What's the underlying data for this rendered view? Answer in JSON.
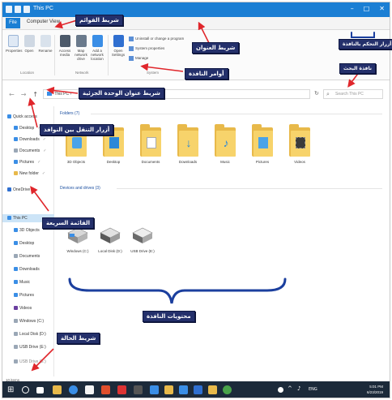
{
  "window": {
    "title": "This PC",
    "controls": [
      "–",
      "□",
      "✕"
    ]
  },
  "ribbon": {
    "tabs": [
      "File",
      "Computer",
      "View"
    ],
    "items": [
      {
        "label": "Properties"
      },
      {
        "label": "Open"
      },
      {
        "label": "Rename"
      },
      {
        "label": "Access media"
      },
      {
        "label": "Map network drive"
      },
      {
        "label": "Add a network location"
      },
      {
        "label": "Open Settings"
      }
    ],
    "small_items": [
      "Uninstall or change a program",
      "System properties",
      "Manage"
    ],
    "groups": [
      "Location",
      "Network",
      "System"
    ]
  },
  "address": {
    "back": "←",
    "forward": "→",
    "up": "↑",
    "path": "This PC",
    "separator": "›",
    "refresh": "↻",
    "search_placeholder": "Search This PC"
  },
  "sidebar": {
    "items": [
      {
        "label": "Quick access",
        "color": "#3a8ee6",
        "pin": ""
      },
      {
        "label": "Desktop",
        "color": "#3a8ee6",
        "pin": "✓"
      },
      {
        "label": "Downloads",
        "color": "#3a8ee6",
        "pin": "✓"
      },
      {
        "label": "Documents",
        "color": "#9aa7b6",
        "pin": "✓"
      },
      {
        "label": "Pictures",
        "color": "#3a8ee6",
        "pin": "✓"
      },
      {
        "label": "New folder",
        "color": "#e8b94a",
        "pin": "✓"
      },
      {
        "label": "OneDrive",
        "color": "#2f6fd0",
        "pin": ""
      },
      {
        "label": "This PC",
        "color": "#3a8ee6",
        "pin": ""
      },
      {
        "label": "3D Objects",
        "color": "#3a8ee6",
        "pin": ""
      },
      {
        "label": "Desktop",
        "color": "#3a8ee6",
        "pin": ""
      },
      {
        "label": "Documents",
        "color": "#9aa7b6",
        "pin": ""
      },
      {
        "label": "Downloads",
        "color": "#3a8ee6",
        "pin": ""
      },
      {
        "label": "Music",
        "color": "#3a8ee6",
        "pin": ""
      },
      {
        "label": "Pictures",
        "color": "#3a8ee6",
        "pin": ""
      },
      {
        "label": "Videos",
        "color": "#6b3fa0",
        "pin": ""
      },
      {
        "label": "Windows (C:)",
        "color": "#9aa7b6",
        "pin": ""
      },
      {
        "label": "Local Disk (D:)",
        "color": "#9aa7b6",
        "pin": ""
      },
      {
        "label": "USB Drive (E:)",
        "color": "#9aa7b6",
        "pin": ""
      },
      {
        "label": "USB Drive (E:)",
        "color": "#9aa7b6",
        "pin": ""
      }
    ]
  },
  "content": {
    "folders_header": "Folders (7)",
    "folders": [
      {
        "label": "3D Objects",
        "emblem": "#4aa3e8"
      },
      {
        "label": "Desktop",
        "emblem": "#2b88d8"
      },
      {
        "label": "Documents",
        "emblem": "#ffffff"
      },
      {
        "label": "Downloads",
        "emblem": "#2b88d8"
      },
      {
        "label": "Music",
        "emblem": "#2b88d8"
      },
      {
        "label": "Pictures",
        "emblem": "#4aa3e8"
      },
      {
        "label": "Videos",
        "emblem": "#3b3b3b"
      }
    ],
    "devices_header": "Devices and drives (3)",
    "drives": [
      {
        "label": "Windows (C:)"
      },
      {
        "label": "Local Disk (D:)"
      },
      {
        "label": "USB Drive (E:)"
      }
    ]
  },
  "statusbar": {
    "text": "10 items"
  },
  "taskbar": {
    "icons": [
      {
        "name": "start",
        "color": "#ffffff"
      },
      {
        "name": "search",
        "color": "#ffffff"
      },
      {
        "name": "task-view",
        "color": "#ffffff"
      },
      {
        "name": "file-explorer",
        "color": "#e8b94a"
      },
      {
        "name": "edge",
        "color": "#3a8ee6"
      },
      {
        "name": "store",
        "color": "#f4f4f4"
      },
      {
        "name": "app",
        "color": "#e04f2c"
      },
      {
        "name": "app",
        "color": "#d33"
      },
      {
        "name": "app",
        "color": "#555"
      },
      {
        "name": "app",
        "color": "#3a8ee6"
      },
      {
        "name": "app",
        "color": "#e8b94a"
      },
      {
        "name": "app",
        "color": "#3a8ee6"
      },
      {
        "name": "app",
        "color": "#2f6fd0"
      },
      {
        "name": "app",
        "color": "#e8b94a"
      },
      {
        "name": "app",
        "color": "#49a34a"
      }
    ],
    "tray": {
      "lang": "ENG",
      "time": "5:01 PM",
      "date": "6/23/2019"
    }
  },
  "annotations": {
    "tabs_bar": "شريط القوائم",
    "title_bar": "شريط العنوان",
    "window_controls": "أزرار التحكم بالنافذة",
    "window_commands": "أوامر النافذة",
    "search_window": "نافذة البحث",
    "address_bar": "شريط عنوان الوحدة الجزئية",
    "nav_buttons": "أزرار التنقل بين النوافذ",
    "quick_list": "القائمة السريعة",
    "window_contents": "محتويات النافذة",
    "status_bar": "شريط الحالة"
  },
  "colors": {
    "accent": "#1b7fd4",
    "callout_bg": "#24306b",
    "arrow": "#e0262b",
    "brace": "#1b3f9e",
    "folder": "#e8b94a",
    "taskbar": "#1c2a3a"
  }
}
